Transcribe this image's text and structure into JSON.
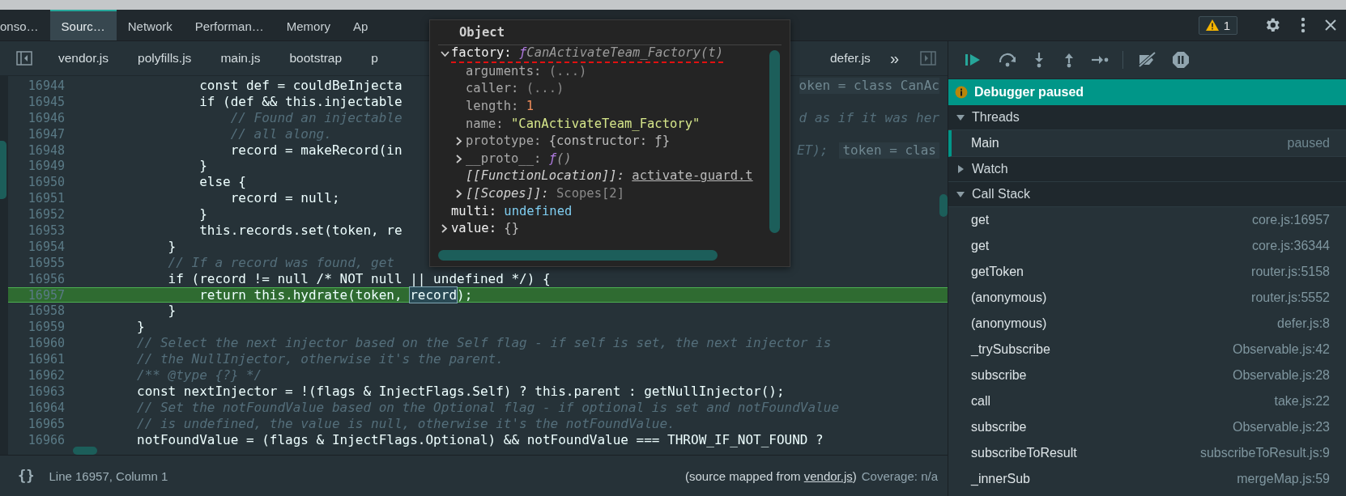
{
  "panel_tabs": [
    {
      "label": "onso…",
      "selected": false
    },
    {
      "label": "Sourc…",
      "selected": true
    },
    {
      "label": "Network",
      "selected": false
    },
    {
      "label": "Performan…",
      "selected": false
    },
    {
      "label": "Memory",
      "selected": false
    },
    {
      "label": "Ap",
      "selected": false
    }
  ],
  "warnings": {
    "count": "1"
  },
  "file_tabs": {
    "left": [
      "vendor.js",
      "polyfills.js",
      "main.js",
      "bootstrap",
      "p"
    ],
    "right": [
      "defer.js"
    ],
    "more": "»"
  },
  "code": {
    "lines": [
      {
        "number": "16944",
        "kind": "code",
        "text": "                const def = couldBeInjecta",
        "tail": "oken = class CanAc"
      },
      {
        "number": "16945",
        "kind": "code",
        "text": "                if (def && this.injectable"
      },
      {
        "number": "16946",
        "kind": "comment",
        "text": "                    // Found an injectable",
        "tail": "d as if it was her"
      },
      {
        "number": "16947",
        "kind": "comment",
        "text": "                    // all along."
      },
      {
        "number": "16948",
        "kind": "code",
        "text": "                    record = makeRecord(in",
        "tail": "ET);",
        "inline_value": "token = clas"
      },
      {
        "number": "16949",
        "kind": "code",
        "text": "                }"
      },
      {
        "number": "16950",
        "kind": "code",
        "text": "                else {"
      },
      {
        "number": "16951",
        "kind": "code",
        "text": "                    record = null;"
      },
      {
        "number": "16952",
        "kind": "code",
        "text": "                }"
      },
      {
        "number": "16953",
        "kind": "code",
        "text": "                this.records.set(token, re"
      },
      {
        "number": "16954",
        "kind": "code",
        "text": "            }"
      },
      {
        "number": "16955",
        "kind": "comment",
        "text": "            // If a record was found, get"
      },
      {
        "number": "16956",
        "kind": "code",
        "text": "            if (record != null /* NOT null || undefined */) {"
      },
      {
        "number": "16957",
        "kind": "paused",
        "text": "                return this.hydrate(token, ",
        "selection": "record",
        "after": ");"
      },
      {
        "number": "16958",
        "kind": "code",
        "text": "            }"
      },
      {
        "number": "16959",
        "kind": "code",
        "text": "        }"
      },
      {
        "number": "16960",
        "kind": "comment",
        "text": "        // Select the next injector based on the Self flag - if self is set, the next injector is"
      },
      {
        "number": "16961",
        "kind": "comment",
        "text": "        // the NullInjector, otherwise it's the parent."
      },
      {
        "number": "16962",
        "kind": "comment",
        "text": "        /** @type {?} */"
      },
      {
        "number": "16963",
        "kind": "code",
        "text": "        const nextInjector = !(flags & InjectFlags.Self) ? this.parent : getNullInjector();"
      },
      {
        "number": "16964",
        "kind": "comment",
        "text": "        // Set the notFoundValue based on the Optional flag - if optional is set and notFoundValue"
      },
      {
        "number": "16965",
        "kind": "comment",
        "text": "        // is undefined, the value is null, otherwise it's the notFoundValue."
      },
      {
        "number": "16966",
        "kind": "code",
        "text": "        notFoundValue = (flags & InjectFlags.Optional) && notFoundValue === THROW_IF_NOT_FOUND ?"
      }
    ]
  },
  "popover": {
    "title": "Object",
    "entries": [
      {
        "key": "factory:",
        "dimmed": false,
        "italic": false,
        "expanded": true,
        "sigil": "ƒ",
        "value": "CanActivateTeam_Factory(t)",
        "kind": "function",
        "marked": true,
        "children": [
          {
            "key": "arguments:",
            "dimmed": true,
            "italic": false,
            "value": "(...)",
            "kind": "plain",
            "marked": false
          },
          {
            "key": "caller:",
            "dimmed": true,
            "italic": false,
            "value": "(...)",
            "kind": "plain",
            "marked": false
          },
          {
            "key": "length:",
            "dimmed": true,
            "italic": false,
            "value": "1",
            "kind": "number",
            "marked": false
          },
          {
            "key": "name:",
            "dimmed": true,
            "italic": false,
            "value": "\"CanActivateTeam_Factory\"",
            "kind": "string",
            "marked": false
          },
          {
            "key": "prototype:",
            "dimmed": true,
            "italic": false,
            "expanded": false,
            "value": "{constructor: ƒ}",
            "kind": "object",
            "marked": false
          },
          {
            "key": "__proto__:",
            "dimmed": true,
            "italic": false,
            "expanded": false,
            "sigil": "ƒ",
            "value": "()",
            "kind": "function",
            "marked": false
          },
          {
            "key": "[[FunctionLocation]]:",
            "dimmed": false,
            "italic": true,
            "value": "activate-guard.t",
            "kind": "link",
            "marked": false
          },
          {
            "key": "[[Scopes]]:",
            "dimmed": false,
            "italic": true,
            "expanded": false,
            "value": "Scopes[2]",
            "kind": "plain",
            "marked": false
          }
        ]
      },
      {
        "key": "multi:",
        "dimmed": false,
        "italic": false,
        "value": "undefined",
        "kind": "undefined",
        "marked": false
      },
      {
        "key": "value:",
        "dimmed": false,
        "italic": false,
        "expanded": false,
        "value": "{}",
        "kind": "object",
        "marked": false
      }
    ]
  },
  "status_bar": {
    "format_button": "{}",
    "position": "Line 16957, Column 1",
    "source_prefix": "(source mapped from ",
    "source_link": "vendor.js",
    "source_suffix": ")",
    "coverage": "Coverage: n/a"
  },
  "sidebar": {
    "banner": "Debugger paused",
    "sections": [
      {
        "kind": "threads",
        "label": "Threads",
        "expanded": true,
        "threads": [
          {
            "name": "Main",
            "status": "paused",
            "selected": true
          }
        ]
      },
      {
        "kind": "watch",
        "label": "Watch",
        "expanded": false
      },
      {
        "kind": "call_stack",
        "label": "Call Stack",
        "expanded": true,
        "frames": [
          {
            "function": "get",
            "location": "core.js:16957"
          },
          {
            "function": "get",
            "location": "core.js:36344"
          },
          {
            "function": "getToken",
            "location": "router.js:5158"
          },
          {
            "function": "(anonymous)",
            "location": "router.js:5552"
          },
          {
            "function": "(anonymous)",
            "location": "defer.js:8"
          },
          {
            "function": "_trySubscribe",
            "location": "Observable.js:42"
          },
          {
            "function": "subscribe",
            "location": "Observable.js:28"
          },
          {
            "function": "call",
            "location": "take.js:22"
          },
          {
            "function": "subscribe",
            "location": "Observable.js:23"
          },
          {
            "function": "subscribeToResult",
            "location": "subscribeToResult.js:9"
          },
          {
            "function": "_innerSub",
            "location": "mergeMap.js:59"
          }
        ]
      }
    ]
  }
}
